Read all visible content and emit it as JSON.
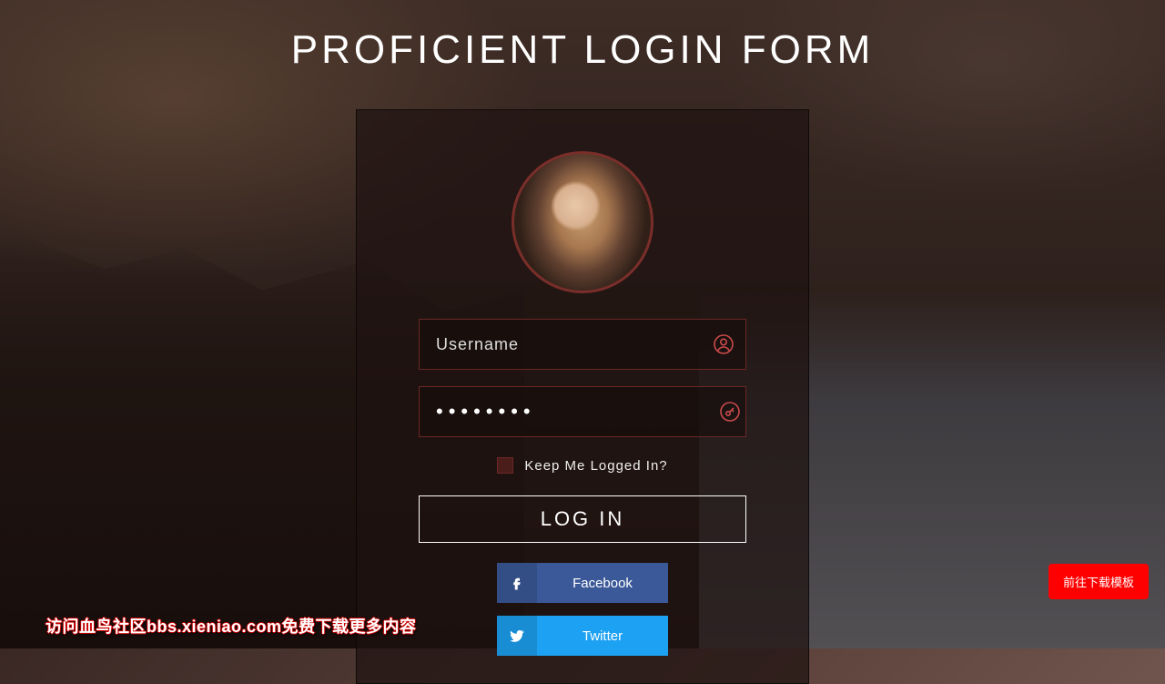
{
  "title": "PROFICIENT LOGIN FORM",
  "form": {
    "username": {
      "placeholder": "Username",
      "value": ""
    },
    "password": {
      "placeholder": "",
      "value": "••••••••"
    },
    "keep_label": "Keep Me Logged In?",
    "login_label": "LOG IN"
  },
  "social": {
    "facebook": "Facebook",
    "twitter": "Twitter"
  },
  "download_button": "前往下载模板",
  "watermark": "访问血鸟社区bbs.xieniao.com免费下载更多内容"
}
